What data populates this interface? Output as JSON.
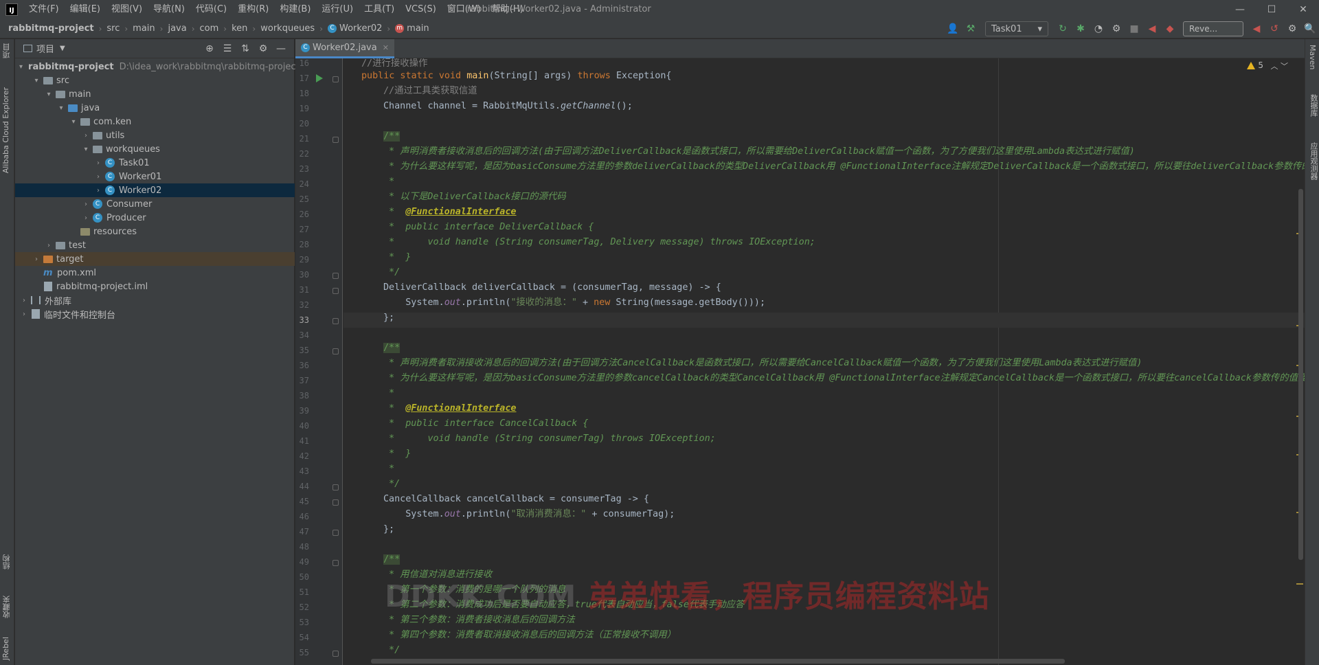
{
  "title_bar": {
    "menu": [
      "文件(F)",
      "编辑(E)",
      "视图(V)",
      "导航(N)",
      "代码(C)",
      "重构(R)",
      "构建(B)",
      "运行(U)",
      "工具(T)",
      "VCS(S)",
      "窗口(W)",
      "帮助(H)"
    ],
    "window_title": "rabbitmq - Worker02.java - Administrator",
    "minimize": "—",
    "maximize": "☐",
    "close": "✕"
  },
  "nav_bar": {
    "breadcrumbs": [
      "rabbitmq-project",
      "src",
      "main",
      "java",
      "com",
      "ken",
      "workqueues",
      "Worker02",
      "main"
    ],
    "run_config": "Task01",
    "search_text": "Reve..."
  },
  "left_strip": {
    "labels": [
      "项目",
      "Alibaba Cloud Explorer",
      "结构",
      "收藏夹",
      "JRebel"
    ]
  },
  "right_strip": {
    "labels": [
      "Maven",
      "数据库",
      "应用观测器"
    ]
  },
  "project_panel": {
    "title": "项目",
    "tree": [
      {
        "label": "rabbitmq-project",
        "hint": "D:\\idea_work\\rabbitmq\\rabbitmq-project"
      },
      {
        "label": "src"
      },
      {
        "label": "main"
      },
      {
        "label": "java"
      },
      {
        "label": "com.ken"
      },
      {
        "label": "utils"
      },
      {
        "label": "workqueues"
      },
      {
        "label": "Task01"
      },
      {
        "label": "Worker01"
      },
      {
        "label": "Worker02"
      },
      {
        "label": "Consumer"
      },
      {
        "label": "Producer"
      },
      {
        "label": "resources"
      },
      {
        "label": "test"
      },
      {
        "label": "target"
      },
      {
        "label": "pom.xml"
      },
      {
        "label": "rabbitmq-project.iml"
      },
      {
        "label": "外部库"
      },
      {
        "label": "临时文件和控制台"
      }
    ]
  },
  "editor": {
    "tab_label": "Worker02.java",
    "warnings": "5",
    "current_line": 33,
    "line_numbers": [
      16,
      17,
      18,
      19,
      20,
      21,
      22,
      23,
      24,
      25,
      26,
      27,
      28,
      29,
      30,
      31,
      32,
      33,
      34,
      35,
      36,
      37,
      38,
      39,
      40,
      41,
      42,
      43,
      44,
      45,
      46,
      47,
      48,
      49,
      50,
      51,
      52,
      53,
      54,
      55
    ],
    "code": {
      "l16": "//进行接收操作",
      "l17_a": "public static void ",
      "l17_fn": "main",
      "l17_b": "(String[] args) ",
      "l17_kw": "throws",
      "l17_c": " Exception{",
      "l18": "//通过工具类获取信道",
      "l19_a": "Channel channel = RabbitMqUtils.",
      "l19_m": "getChannel",
      "l19_b": "();",
      "l21": "/**",
      "l22": " * 声明消费者接收消息后的回调方法(由于回调方法DeliverCallback是函数式接口，所以需要给DeliverCallback赋值一个函数，为了方便我们这里使用Lambda表达式进行赋值)",
      "l23_a": " * 为什么要这样写呢，是因为basicConsume方法里的参数deliverCallback的类型DeliverCallback用 ",
      "l23_ann": "@FunctionalInterface",
      "l23_b": "注解规定DeliverCallback是一个函数式接口，所以要往deliverCallback参数传的值",
      "l24": " *",
      "l25": " * 以下是DeliverCallback接口的源代码",
      "l26_a": " *  ",
      "l26_ann": "@FunctionalInterface",
      "l27": " *  public interface DeliverCallback {",
      "l28": " *      void handle (String consumerTag, Delivery message) throws IOException;",
      "l29": " *  }",
      "l30": " */",
      "l31": "DeliverCallback deliverCallback = (consumerTag, message) -> {",
      "l32_a": "    System.",
      "l32_out": "out",
      "l32_b": ".println(",
      "l32_str": "\"接收的消息：\"",
      "l32_c": " + ",
      "l32_kw": "new",
      "l32_d": " String(message.getBody()));",
      "l33": "};",
      "l35": "/**",
      "l36": " * 声明消费者取消接收消息后的回调方法(由于回调方法CancelCallback是函数式接口，所以需要给CancelCallback赋值一个函数，为了方便我们这里使用Lambda表达式进行赋值)",
      "l37_a": " * 为什么要这样写呢，是因为basicConsume方法里的参数cancelCallback的类型CancelCallback用 ",
      "l37_ann": "@FunctionalInterface",
      "l37_b": "注解规定CancelCallback是一个函数式接口，所以要往cancelCallback参数传的值要是",
      "l38": " *",
      "l39_a": " *  ",
      "l39_ann": "@FunctionalInterface",
      "l40": " *  public interface CancelCallback {",
      "l41": " *      void handle (String consumerTag) throws IOException;",
      "l42": " *  }",
      "l43": " *",
      "l44": " */",
      "l45": "CancelCallback cancelCallback = consumerTag -> {",
      "l46_a": "    System.",
      "l46_out": "out",
      "l46_b": ".println(",
      "l46_str": "\"取消消费消息：\"",
      "l46_c": " + consumerTag);",
      "l47": "};",
      "l49": "/**",
      "l50": " * 用信道对消息进行接收",
      "l51": " * 第一个参数：消费的是哪一个队列的消息",
      "l52": " * 第二个参数：消费成功后是否要自动应答，true代表自动应当，false代表手动应答",
      "l53": " * 第三个参数：消费者接收消息后的回调方法",
      "l54": " * 第四个参数：消费者取消接收消息后的回调方法（正常接收不调用）",
      "l55": " */"
    }
  },
  "watermark": {
    "part1": "DDKK.COM ",
    "part2": "弟弟快看，程序员编程资料站"
  }
}
